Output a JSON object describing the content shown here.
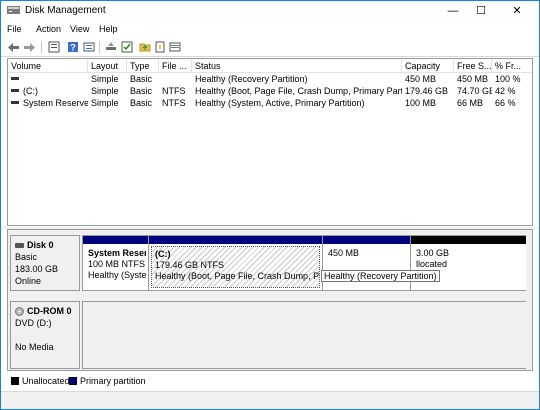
{
  "window": {
    "title": "Disk Management",
    "controls": {
      "minimize": "—",
      "maximize": "☐",
      "close": "✕"
    },
    "accent": "#1883d7"
  },
  "menu": [
    "File",
    "Action",
    "View",
    "Help"
  ],
  "toolbar": {
    "buttons": [
      "back-icon",
      "forward-icon",
      "properties-icon",
      "help-icon",
      "rescan-icon",
      "check-icon",
      "folder-icon",
      "list-view-icon"
    ]
  },
  "volume_list": {
    "columns": [
      "Volume",
      "Layout",
      "Type",
      "File ...",
      "Status",
      "Capacity",
      "Free S...",
      "% Fr..."
    ],
    "rows": [
      {
        "volume": "",
        "layout": "Simple",
        "type": "Basic",
        "fs": "",
        "status": "Healthy (Recovery Partition)",
        "capacity": "450 MB",
        "free": "450 MB",
        "pct": "100 %"
      },
      {
        "volume": "(C:)",
        "layout": "Simple",
        "type": "Basic",
        "fs": "NTFS",
        "status": "Healthy (Boot, Page File, Crash Dump, Primary Partition)",
        "capacity": "179.46 GB",
        "free": "74.70 GB",
        "pct": "42 %"
      },
      {
        "volume": "System Reserved",
        "layout": "Simple",
        "type": "Basic",
        "fs": "NTFS",
        "status": "Healthy (System, Active, Primary Partition)",
        "capacity": "100 MB",
        "free": "66 MB",
        "pct": "66 %"
      }
    ]
  },
  "disks": [
    {
      "name": "Disk 0",
      "type": "Basic",
      "size": "183.00 GB",
      "status": "Online",
      "partitions": [
        {
          "name": "System Reserv",
          "size": "100 MB NTFS",
          "status": "Healthy (Systen",
          "bar_color": "#00007f"
        },
        {
          "name": "(C:)",
          "size": "179.46 GB NTFS",
          "status": "Healthy (Boot, Page File, Crash Dump, Primar",
          "bar_color": "#00007f"
        },
        {
          "name": "",
          "size": "450 MB",
          "status": "",
          "bar_color": "#00007f"
        },
        {
          "name": "",
          "size": "3.00 GB",
          "status": "llocated",
          "bar_color": "#000000"
        }
      ]
    }
  ],
  "cdrom": {
    "name": "CD-ROM 0",
    "drive": "DVD (D:)",
    "media": "No Media"
  },
  "tooltip": "Healthy (Recovery Partition)",
  "legend": [
    {
      "label": "Unallocated",
      "color": "#000000"
    },
    {
      "label": "Primary partition",
      "color": "#00007f"
    }
  ]
}
